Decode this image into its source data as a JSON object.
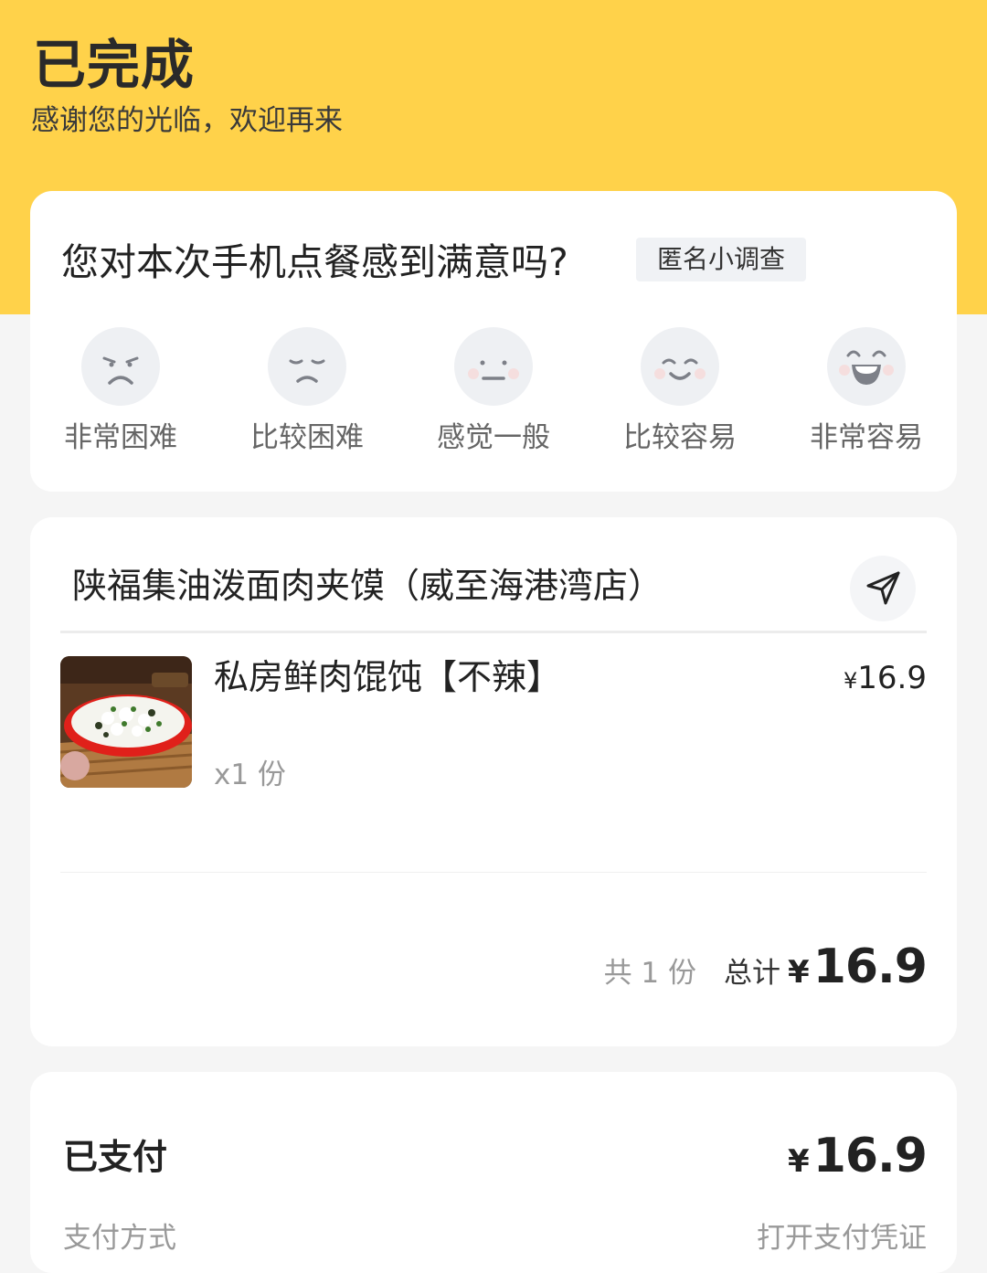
{
  "header": {
    "status_title": "已完成",
    "status_subtitle": "感谢您的光临，欢迎再来",
    "background_color": "#ffd24a"
  },
  "survey": {
    "question": "您对本次手机点餐感到满意吗?",
    "tag": "匿名小调查",
    "options": [
      {
        "label": "非常困难",
        "icon": "very-hard-face-icon"
      },
      {
        "label": "比较困难",
        "icon": "hard-face-icon"
      },
      {
        "label": "感觉一般",
        "icon": "neutral-face-icon"
      },
      {
        "label": "比较容易",
        "icon": "easy-face-icon"
      },
      {
        "label": "非常容易",
        "icon": "very-easy-face-icon"
      }
    ]
  },
  "order": {
    "shop_name": "陕福集油泼面肉夹馍（威至海港湾店）",
    "navigation_icon": "navigation-arrow-icon",
    "items": [
      {
        "name": "私房鲜肉馄饨【不辣】",
        "currency": "¥",
        "price": "16.9",
        "quantity": "x1 份",
        "image": "wonton-soup-image"
      }
    ],
    "summary": {
      "count": "共 1 份",
      "total_label": "总计",
      "currency": "¥",
      "total": "16.9"
    }
  },
  "payment": {
    "status": "已支付",
    "currency": "¥",
    "amount": "16.9",
    "row2_left": "支付方式",
    "row2_right": "打开支付凭证"
  }
}
